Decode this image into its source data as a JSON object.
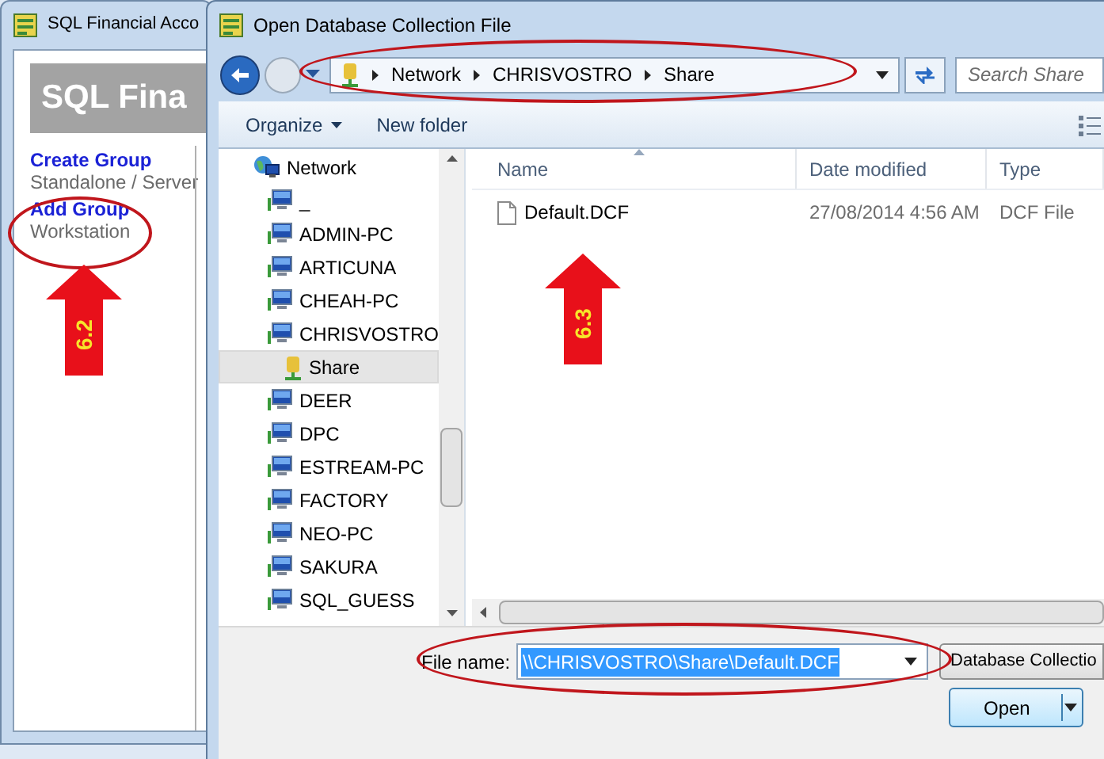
{
  "background_window": {
    "title": "SQL Financial Acco",
    "banner": "SQL Fina",
    "links": [
      {
        "label": "Create Group",
        "caption": "Standalone / Server"
      },
      {
        "label": "Add Group",
        "caption": "Workstation"
      }
    ]
  },
  "dialog": {
    "title": "Open Database Collection File",
    "address": {
      "crumbs": [
        "Network",
        "CHRISVOSTRO",
        "Share"
      ]
    },
    "search": {
      "placeholder": "Search Share"
    },
    "toolbar": [
      {
        "label": "Organize",
        "dropdown": true
      },
      {
        "label": "New folder",
        "dropdown": false
      }
    ],
    "nav_tree": [
      {
        "label": "Network",
        "selected": false,
        "children": [
          {
            "label": "_",
            "selected": false
          },
          {
            "label": "ADMIN-PC",
            "selected": false
          },
          {
            "label": "ARTICUNA",
            "selected": false
          },
          {
            "label": "CHEAH-PC",
            "selected": false
          },
          {
            "label": "CHRISVOSTRO",
            "selected": false,
            "children": [
              {
                "label": "Share",
                "selected": true
              }
            ]
          },
          {
            "label": "DEER",
            "selected": false
          },
          {
            "label": "DPC",
            "selected": false
          },
          {
            "label": "ESTREAM-PC",
            "selected": false
          },
          {
            "label": "FACTORY",
            "selected": false
          },
          {
            "label": "NEO-PC",
            "selected": false
          },
          {
            "label": "SAKURA",
            "selected": false
          },
          {
            "label": "SQL_GUESS",
            "selected": false
          }
        ]
      }
    ],
    "columns": [
      "Name",
      "Date modified",
      "Type"
    ],
    "files": [
      {
        "name": "Default.DCF",
        "date_modified": "27/08/2014 4:56 AM",
        "type": "DCF File"
      }
    ],
    "file_name": {
      "label": "File name:",
      "value": "\\\\CHRISVOSTRO\\Share\\Default.DCF"
    },
    "file_type": "Database Collectio",
    "buttons": [
      "Open"
    ]
  },
  "callouts": [
    {
      "label": "6.2"
    },
    {
      "label": "6.3"
    }
  ]
}
